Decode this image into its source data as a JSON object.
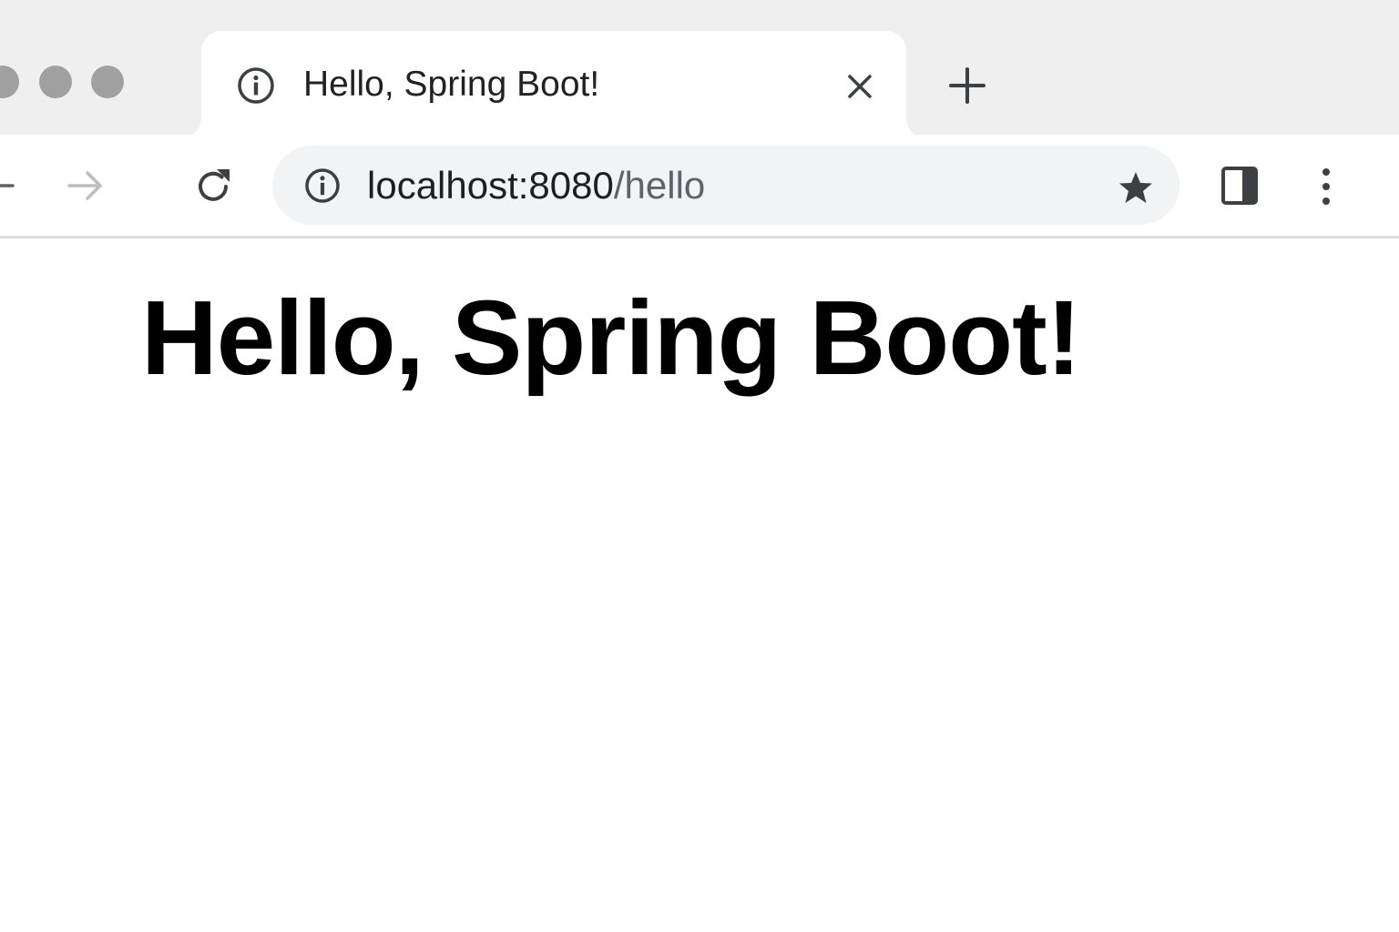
{
  "tab": {
    "title": "Hello, Spring Boot!",
    "icon": "info-icon",
    "close_icon": "close-icon",
    "new_tab_icon": "plus-icon"
  },
  "toolbar": {
    "back_icon": "arrow-left-icon",
    "forward_icon": "arrow-right-icon",
    "reload_icon": "reload-icon",
    "site_info_icon": "info-icon",
    "bookmark_icon": "star-icon",
    "side_panel_icon": "side-panel-icon",
    "menu_icon": "kebab-menu-icon"
  },
  "omnibox": {
    "host": "localhost:8080",
    "path": "/hello"
  },
  "page": {
    "heading": "Hello, Spring Boot!"
  },
  "colors": {
    "tabstrip_bg": "#efefef",
    "omnibox_bg": "#f2f3f5",
    "icon_dark": "#3c4043",
    "icon_disabled": "#bdbdbd",
    "traffic_light": "#a0a0a0"
  }
}
